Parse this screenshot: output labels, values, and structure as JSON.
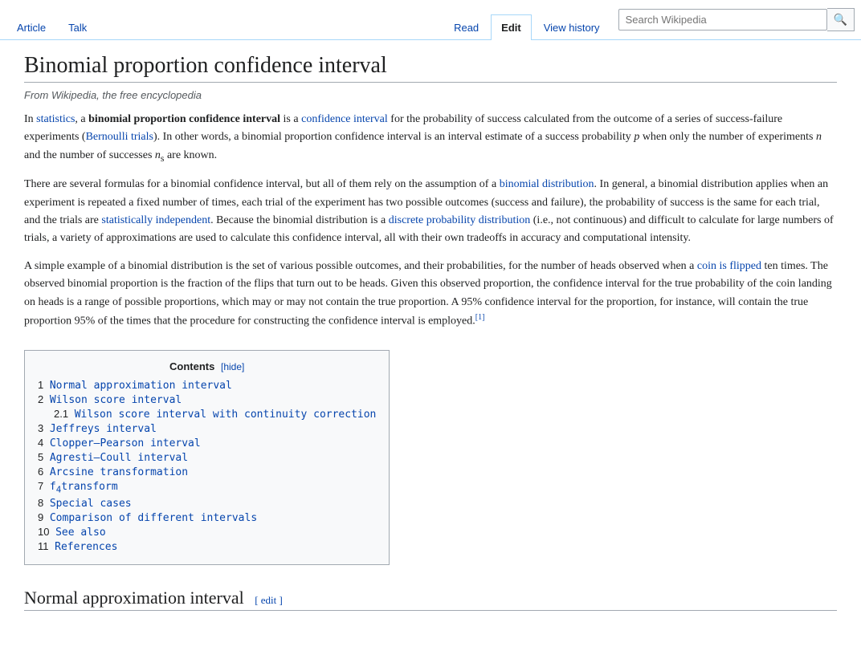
{
  "tabs": {
    "article": "Article",
    "talk": "Talk"
  },
  "actions": {
    "read": "Read",
    "edit": "Edit",
    "view_history": "View history"
  },
  "search": {
    "placeholder": "Search Wikipedia"
  },
  "page": {
    "title": "Binomial proportion confidence interval",
    "from_line": "From Wikipedia, the free encyclopedia",
    "intro_paragraphs": [
      "In statistics, a binomial proportion confidence interval is a confidence interval for the probability of success calculated from the outcome of a series of success–failure experiments (Bernoulli trials). In other words, a binomial proportion confidence interval is an interval estimate of a success probability p when only the number of experiments n and the number of successes ns are known.",
      "There are several formulas for a binomial confidence interval, but all of them rely on the assumption of a binomial distribution. In general, a binomial distribution applies when an experiment is repeated a fixed number of times, each trial of the experiment has two possible outcomes (success and failure), the probability of success is the same for each trial, and the trials are statistically independent. Because the binomial distribution is a discrete probability distribution (i.e., not continuous) and difficult to calculate for large numbers of trials, a variety of approximations are used to calculate this confidence interval, all with their own tradeoffs in accuracy and computational intensity.",
      "A simple example of a binomial distribution is the set of various possible outcomes, and their probabilities, for the number of heads observed when a coin is flipped ten times. The observed binomial proportion is the fraction of the flips that turn out to be heads. Given this observed proportion, the confidence interval for the true probability of the coin landing on heads is a range of possible proportions, which may or may not contain the true proportion. A 95% confidence interval for the proportion, for instance, will contain the true proportion 95% of the times that the procedure for constructing the confidence interval is employed.[1]"
    ],
    "toc": {
      "title": "Contents",
      "hide_label": "[hide]",
      "items": [
        {
          "num": "1",
          "label": "Normal approximation interval",
          "sub": []
        },
        {
          "num": "2",
          "label": "Wilson score interval",
          "sub": [
            {
              "num": "2.1",
              "label": "Wilson score interval with continuity correction"
            }
          ]
        },
        {
          "num": "3",
          "label": "Jeffreys interval",
          "sub": []
        },
        {
          "num": "4",
          "label": "Clopper–Pearson interval",
          "sub": []
        },
        {
          "num": "5",
          "label": "Agresti–Coull interval",
          "sub": []
        },
        {
          "num": "6",
          "label": "Arcsine transformation",
          "sub": []
        },
        {
          "num": "7",
          "label": "f4 transform",
          "sub": []
        },
        {
          "num": "8",
          "label": "Special cases",
          "sub": []
        },
        {
          "num": "9",
          "label": "Comparison of different intervals",
          "sub": []
        },
        {
          "num": "10",
          "label": "See also",
          "sub": []
        },
        {
          "num": "11",
          "label": "References",
          "sub": []
        }
      ]
    },
    "section_normal_approx": {
      "title": "Normal approximation interval",
      "edit_label": "[ edit ]"
    }
  },
  "colors": {
    "link": "#0645ad",
    "border": "#a2a9b1",
    "toc_bg": "#f8f9fa"
  }
}
